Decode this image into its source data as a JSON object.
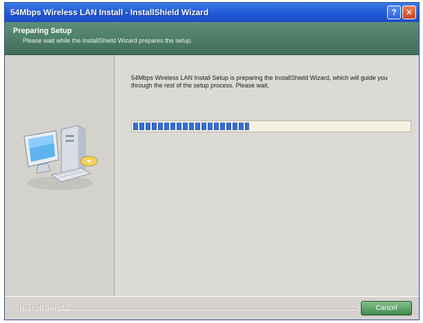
{
  "window": {
    "title": "54Mbps Wireless LAN Install - InstallShield Wizard",
    "help_glyph": "?",
    "close_glyph": "✕"
  },
  "header": {
    "title": "Preparing Setup",
    "subtitle": "Please wait while the InstallShield Wizard prepares the setup."
  },
  "content": {
    "message": "54Mbps Wireless LAN Install Setup is preparing the InstallShield Wizard, which will guide you through the rest of the setup process. Please wait."
  },
  "progress": {
    "fraction": 0.42
  },
  "footer": {
    "brand": "InstallShield",
    "cancel_label": "Cancel"
  },
  "colors": {
    "titlebar": "#1f56d6",
    "header": "#4f7e6a",
    "progress_fill": "#2e5fc2",
    "cancel_button": "#3f8a4e"
  },
  "icons": {
    "sidebar_graphic": "computer-icon"
  }
}
